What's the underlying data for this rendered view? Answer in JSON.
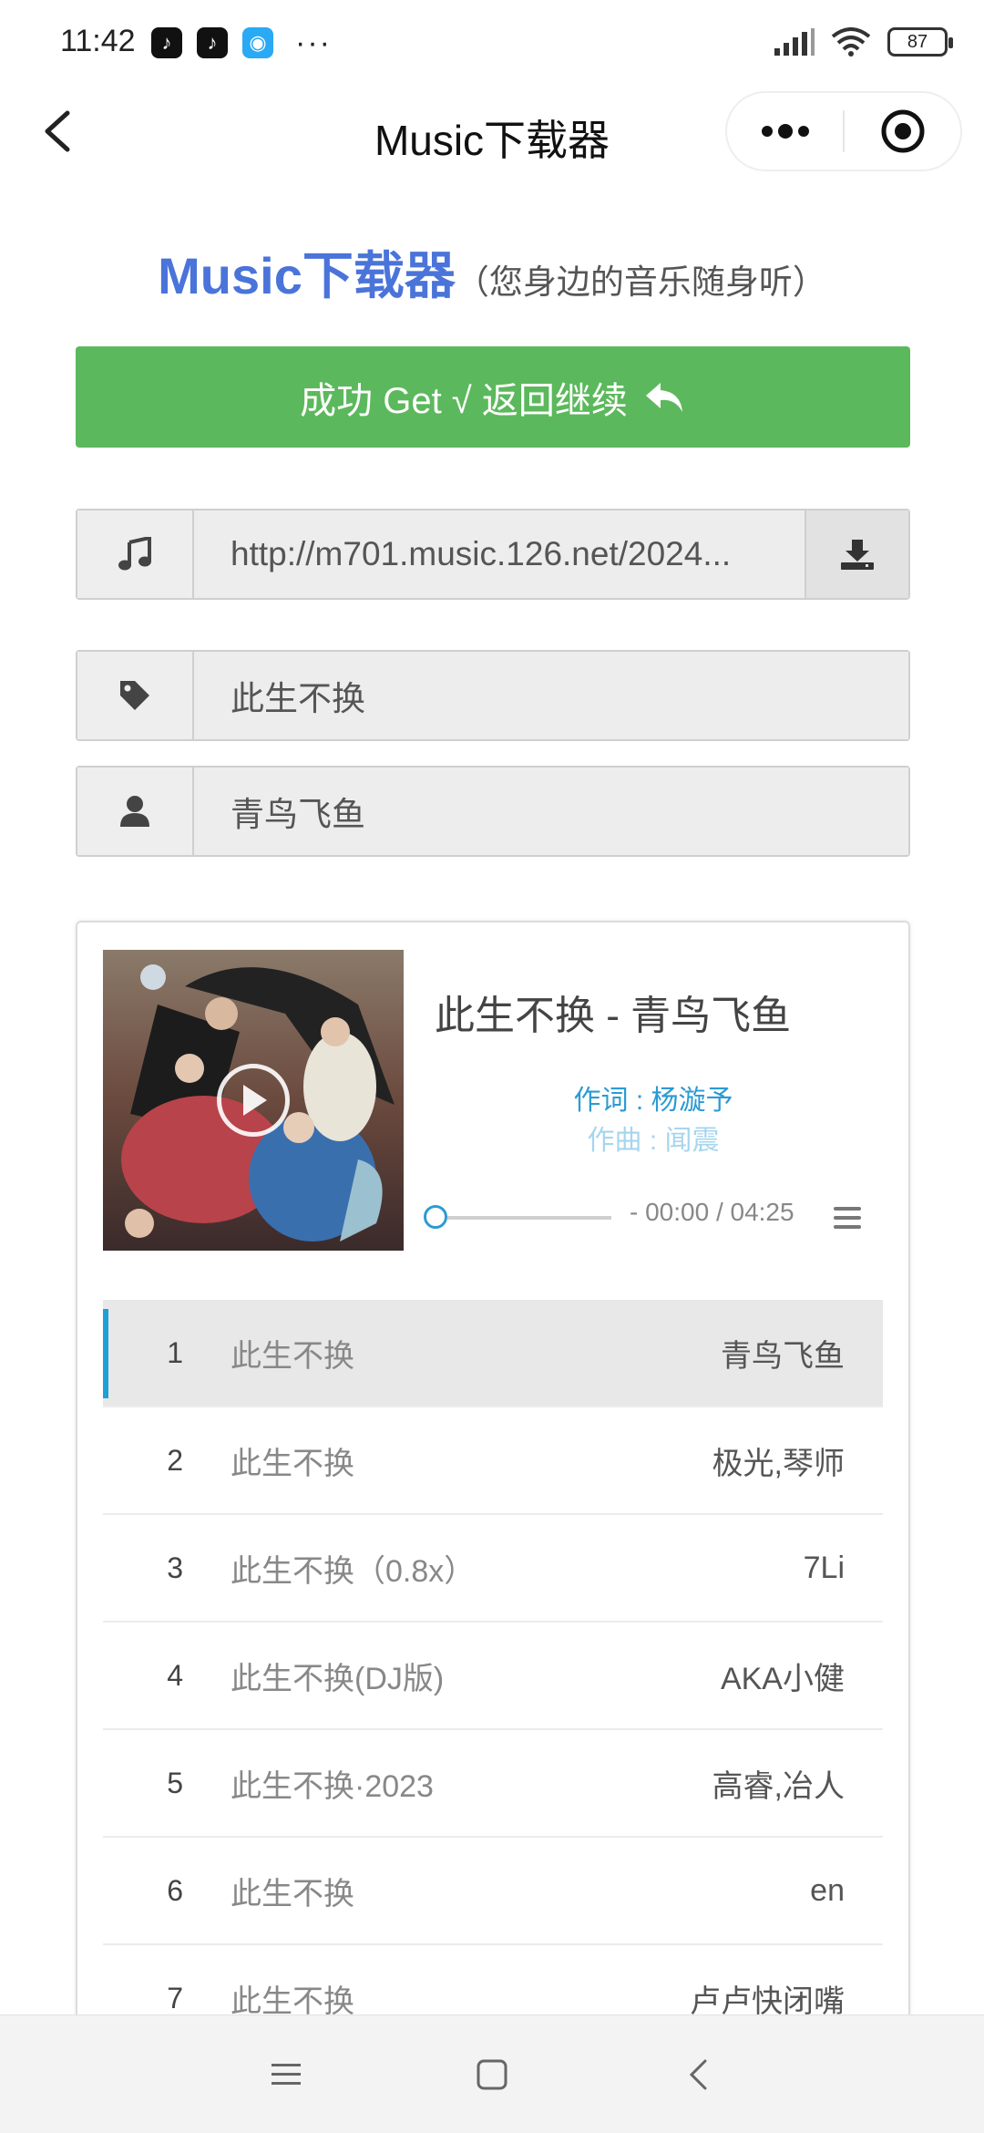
{
  "status_bar": {
    "time": "11:42",
    "more": "···",
    "battery": "87"
  },
  "nav": {
    "title": "Music下载器"
  },
  "header": {
    "brand": "Music下载器",
    "subtitle": "（您身边的音乐随身听）"
  },
  "success_button": {
    "label": "成功 Get √ 返回继续"
  },
  "fields": {
    "url": "http://m701.music.126.net/2024...",
    "song_name": "此生不换",
    "artist": "青鸟飞鱼"
  },
  "player": {
    "song_title": "此生不换 - 青鸟飞鱼",
    "lyric_active": "作词 : 杨漩予",
    "lyric_next": "作曲 : 闻震",
    "time_display": "- 00:00 / 04:25",
    "progress": 0
  },
  "playlist": [
    {
      "num": "1",
      "title": "此生不换",
      "artist": "青鸟飞鱼",
      "active": true
    },
    {
      "num": "2",
      "title": "此生不换",
      "artist": "极光,琴师",
      "active": false
    },
    {
      "num": "3",
      "title": "此生不换（0.8x）",
      "artist": "7Li",
      "active": false
    },
    {
      "num": "4",
      "title": "此生不换(DJ版)",
      "artist": "AKA小健",
      "active": false
    },
    {
      "num": "5",
      "title": "此生不换·2023",
      "artist": "高睿,冶人",
      "active": false
    },
    {
      "num": "6",
      "title": "此生不换",
      "artist": "en",
      "active": false
    },
    {
      "num": "7",
      "title": "此生不换",
      "artist": "卢卢快闭嘴",
      "active": false
    }
  ],
  "colors": {
    "brand": "#4a74d9",
    "success": "#5cb85c",
    "accent": "#2b9bd3"
  },
  "icons": {
    "nav_back": "chevron-left-icon",
    "more": "more-dots-icon",
    "close": "target-circle-icon",
    "music": "music-note-icon",
    "download": "download-icon",
    "tag": "tag-icon",
    "user": "user-icon",
    "reply": "reply-arrow-icon",
    "play": "play-icon",
    "list": "list-icon"
  }
}
